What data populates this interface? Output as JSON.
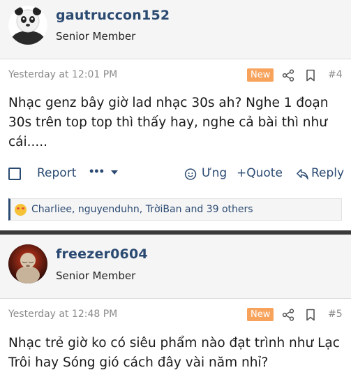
{
  "posts": [
    {
      "username": "gautruccon152",
      "user_title": "Senior Member",
      "avatar": "panda-avatar",
      "time": "Yesterday at 12:01 PM",
      "badge": "New",
      "post_number": "#4",
      "content": "Nhạc genz bây giờ lad nhạc 30s ah? Nghe 1 đoạn 30s trên top top thì thấy hay, nghe cả bài thì như cái.....",
      "actions": {
        "report": "Report",
        "more": "•••",
        "react": "Ưng",
        "quote": "+Quote",
        "reply": "Reply"
      },
      "reactions": "Charliee, nguyenduhn, TrờiBan and 39 others"
    },
    {
      "username": "freezer0604",
      "user_title": "Senior Member",
      "avatar": "monk-statue-avatar",
      "time": "Yesterday at 12:48 PM",
      "badge": "New",
      "post_number": "#5",
      "content": "Nhạc trẻ giờ ko có siêu phẩm nào đạt trình như Lạc Trôi hay Sóng gió cách đây vài năm nhỉ?"
    }
  ],
  "colors": {
    "accent": "#2b4a72",
    "badge": "#f7a35c",
    "meta_text": "#8a8a8a",
    "header_bg": "#f5f5f5"
  }
}
